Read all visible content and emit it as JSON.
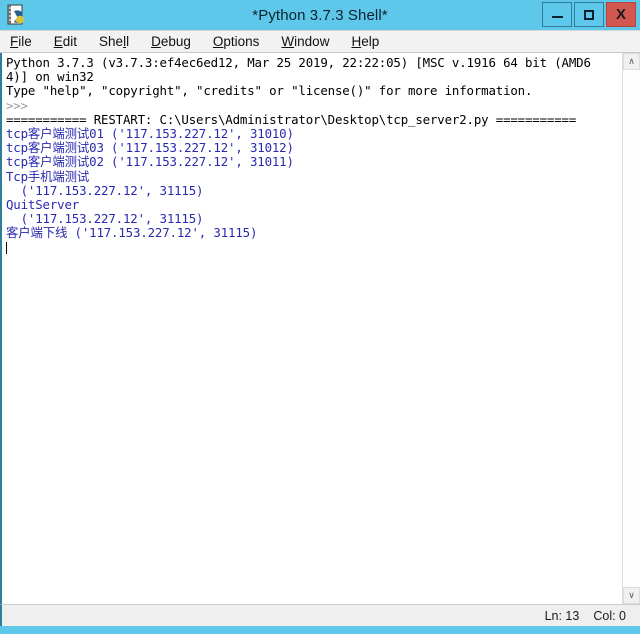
{
  "window": {
    "title": "*Python 3.7.3 Shell*",
    "icon": "python-idle-icon",
    "frame_color": "#5ec8ea",
    "controls": [
      {
        "name": "minimize-button",
        "label": "–"
      },
      {
        "name": "maximize-button",
        "label": "□"
      },
      {
        "name": "close-button",
        "label": "X",
        "color": "#d1574f"
      }
    ]
  },
  "menubar": {
    "items": [
      {
        "label": "File",
        "mnemonic": "F"
      },
      {
        "label": "Edit",
        "mnemonic": "E"
      },
      {
        "label": "Shell",
        "mnemonic": "l"
      },
      {
        "label": "Debug",
        "mnemonic": "D"
      },
      {
        "label": "Options",
        "mnemonic": "O"
      },
      {
        "label": "Window",
        "mnemonic": "W"
      },
      {
        "label": "Help",
        "mnemonic": "H"
      }
    ]
  },
  "shell": {
    "text_colors": {
      "stdout": "#2a2ab0",
      "prompt": "#9a9a9a",
      "normal": "#000000"
    },
    "lines": [
      {
        "type": "normal",
        "text": "Python 3.7.3 (v3.7.3:ef4ec6ed12, Mar 25 2019, 22:22:05) [MSC v.1916 64 bit (AMD6"
      },
      {
        "type": "normal",
        "text": "4)] on win32"
      },
      {
        "type": "normal",
        "text": "Type \"help\", \"copyright\", \"credits\" or \"license()\" for more information."
      },
      {
        "type": "prompt",
        "text": ">>>"
      },
      {
        "type": "restart",
        "text": "=========== RESTART: C:\\Users\\Administrator\\Desktop\\tcp_server2.py ==========="
      },
      {
        "type": "stdout",
        "text": "tcp客户端测试01 ('117.153.227.12', 31010)"
      },
      {
        "type": "stdout",
        "text": "tcp客户端测试03 ('117.153.227.12', 31012)"
      },
      {
        "type": "stdout",
        "text": "tcp客户端测试02 ('117.153.227.12', 31011)"
      },
      {
        "type": "stdout",
        "text": "Tcp手机端测试"
      },
      {
        "type": "stdout",
        "text": "  ('117.153.227.12', 31115)"
      },
      {
        "type": "stdout",
        "text": "QuitServer"
      },
      {
        "type": "stdout",
        "text": "  ('117.153.227.12', 31115)"
      },
      {
        "type": "stdout",
        "text": "客户端下线 ('117.153.227.12', 31115)"
      }
    ]
  },
  "scrollbar": {
    "up_arrow": "∧",
    "down_arrow": "∨"
  },
  "statusbar": {
    "line_label": "Ln: 13",
    "col_label": "Col: 0"
  }
}
